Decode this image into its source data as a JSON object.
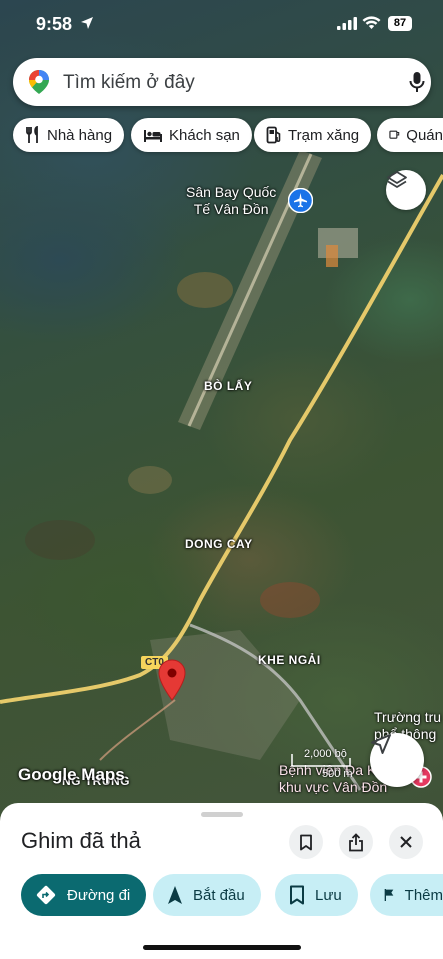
{
  "status_bar": {
    "time": "9:58",
    "battery": "87"
  },
  "search": {
    "placeholder": "Tìm kiếm ở đây"
  },
  "chips": [
    {
      "label": "Nhà hàng",
      "icon": "fork-knife-icon"
    },
    {
      "label": "Khách sạn",
      "icon": "bed-icon"
    },
    {
      "label": "Trạm xăng",
      "icon": "gas-pump-icon"
    },
    {
      "label": "Quán",
      "icon": "coffee-cup-icon"
    }
  ],
  "map": {
    "airport": {
      "line1": "Sân Bay Quốc",
      "line2": "Tế Vân Đồn"
    },
    "places": {
      "bo_lay": "BÒ LẤY",
      "dong_cay": "DONG CAY",
      "khe_ngai": "KHE NGẢI",
      "bottom_left": "NG TRUNG"
    },
    "road_label": "CT0",
    "poi_school": {
      "line1": "Trường tru",
      "line2": "phổ thông l"
    },
    "poi_hospital": {
      "line1": "Bệnh viện Đa K",
      "line2": "khu vực Vân Đồn"
    },
    "scale": {
      "feet": "2,000 bộ",
      "meters": "500 m"
    },
    "attribution": "Google Maps",
    "colors": {
      "road": "#e5c96a",
      "pin": "#e53935"
    }
  },
  "sheet": {
    "title": "Ghim đã thả",
    "actions": [
      {
        "label": "Đường đi",
        "icon": "directions-icon"
      },
      {
        "label": "Bắt đầu",
        "icon": "navigation-arrow-icon"
      },
      {
        "label": "Lưu",
        "icon": "bookmark-icon"
      },
      {
        "label": "Thêm",
        "icon": "flag-icon"
      }
    ],
    "colors": {
      "primary": "#0b6a70",
      "secondary": "#c7eef5"
    }
  }
}
